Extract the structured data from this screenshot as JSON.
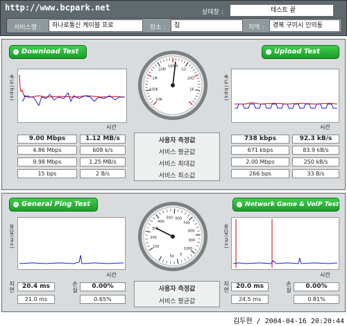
{
  "header": {
    "url": "http://www.bcpark.net",
    "status_label": "상태창 :",
    "status_value": "테스트 끝",
    "service_label": "서비스명 :",
    "service_value": "하나로통신 케이블 프로",
    "place_label": "장소 :",
    "place_value": "집",
    "region_label": "지역 :",
    "region_value": "경북 구미시 인의동"
  },
  "download": {
    "title": "Download Test",
    "axis_y": "속도(bps)",
    "axis_x": "시간",
    "rows": [
      [
        "9.00 Mbps",
        "1.12 MB/s"
      ],
      [
        "4.86 Mbps",
        "608 k/s"
      ],
      [
        "9.98 Mbps",
        "1.25 MB/s"
      ],
      [
        "15 bps",
        "2 B/s"
      ]
    ]
  },
  "upload": {
    "title": "Upload Test",
    "axis_y": "속도(bps)",
    "axis_x": "시간",
    "rows": [
      [
        "738 kbps",
        "92.3 kB/s"
      ],
      [
        "671 kbps",
        "83.9 kB/s"
      ],
      [
        "2.00 Mbps",
        "250 kB/s"
      ],
      [
        "266 bps",
        "33 B/s"
      ]
    ]
  },
  "metrics_center": [
    "사용자 측정값",
    "서비스 평균값",
    "서비스 최대값",
    "서비스 최소값"
  ],
  "gauge_top": {
    "labels": [
      "10K",
      "100K",
      "1M",
      "10M",
      "100M",
      "1G",
      "10G",
      "1K"
    ],
    "needle_level": "9.00 Mbps"
  },
  "ping": {
    "title": "General Ping Test",
    "axis_y": "응답(ms)",
    "axis_x": "시간",
    "side_lbl_1": "지연",
    "side_lbl_2": "손실",
    "rows": [
      [
        "20.4 ms",
        "0.00%"
      ],
      [
        "21.0 ms",
        "0.65%"
      ]
    ]
  },
  "game": {
    "title": "Network Game & VoIP Test",
    "axis_y": "응답(ms)",
    "axis_x": "시간",
    "side_lbl_1": "지연",
    "side_lbl_2": "손실",
    "rows": [
      [
        "20.0 ms",
        "0.00%"
      ],
      [
        "24.5 ms",
        "0.81%"
      ]
    ]
  },
  "metrics_center_bottom": [
    "사용자 측정값",
    "서비스 평균값"
  ],
  "gauge_bottom": {
    "labels": [
      "100",
      "200",
      "300",
      "400",
      "500",
      "600",
      "700",
      "800",
      "900",
      "1000",
      "0",
      "50"
    ]
  },
  "footer": "김두현 / 2004-04-16 20:20:44",
  "colors": {
    "pill_green": "#22b030",
    "graph_red": "#cc0000",
    "graph_blue": "#1a1acc",
    "header_bg": "#5e6a6e"
  }
}
